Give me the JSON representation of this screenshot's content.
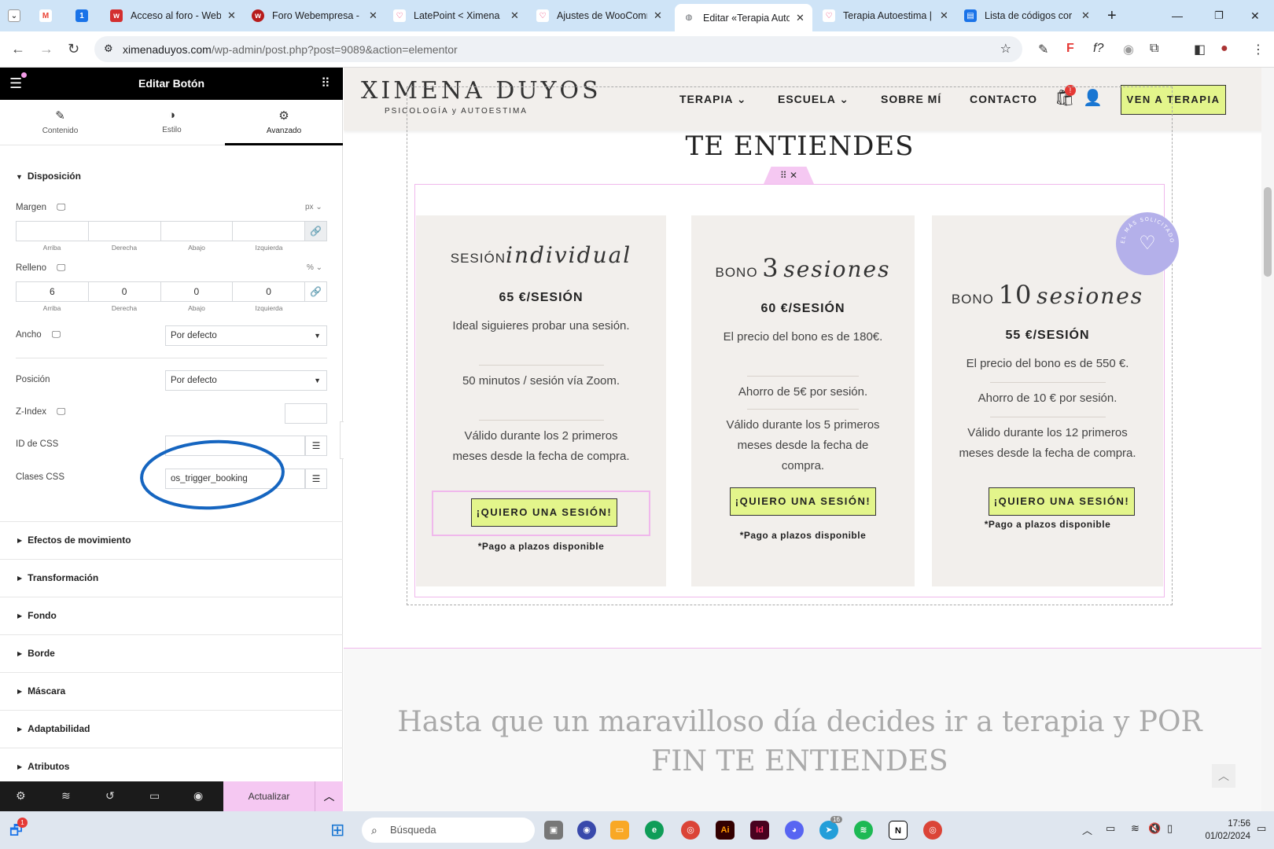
{
  "browser": {
    "tabs": [
      {
        "title": "",
        "icon": "gmail-icon",
        "color": "#ea4335"
      },
      {
        "title": "",
        "icon": "calendar-icon",
        "color": "#1a73e8"
      },
      {
        "title": "Acceso al foro - Web",
        "icon": "webempresa-icon",
        "color": "#d32f2f"
      },
      {
        "title": "Foro Webempresa - F",
        "icon": "webempresa-icon",
        "color": "#b71c1c"
      },
      {
        "title": "LatePoint < Ximena",
        "icon": "heart-icon",
        "color": "#e91e63"
      },
      {
        "title": "Ajustes de WooComm",
        "icon": "heart-icon",
        "color": "#e91e63"
      },
      {
        "title": "Editar «Terapia Auto",
        "icon": "globe-icon",
        "color": "#5f6368"
      },
      {
        "title": "Terapia Autoestima |",
        "icon": "heart-icon",
        "color": "#e91e63"
      },
      {
        "title": "Lista de códigos cor",
        "icon": "docs-icon",
        "color": "#1a73e8"
      }
    ],
    "url_host": "ximenaduyos.com",
    "url_path": "/wp-admin/post.php?post=9089&action=elementor"
  },
  "panel": {
    "title": "Editar Botón",
    "tabs": [
      "Contenido",
      "Estilo",
      "Avanzado"
    ],
    "section": "Disposición",
    "margin": {
      "label": "Margen",
      "unit": "px",
      "values": [
        "",
        "",
        "",
        ""
      ]
    },
    "padding": {
      "label": "Relleno",
      "unit": "%",
      "values": [
        "6",
        "0",
        "0",
        "0"
      ]
    },
    "sides": [
      "Arriba",
      "Derecha",
      "Abajo",
      "Izquierda"
    ],
    "width": {
      "label": "Ancho",
      "value": "Por defecto"
    },
    "position": {
      "label": "Posición",
      "value": "Por defecto"
    },
    "zindex": {
      "label": "Z-Index",
      "value": ""
    },
    "css_id": {
      "label": "ID de CSS",
      "value": ""
    },
    "css_classes": {
      "label": "Clases CSS",
      "value": "os_trigger_booking"
    },
    "accordions": [
      "Efectos de movimiento",
      "Transformación",
      "Fondo",
      "Borde",
      "Máscara",
      "Adaptabilidad",
      "Atributos"
    ],
    "update_label": "Actualizar"
  },
  "site": {
    "logo": "XIMENA DUYOS",
    "logo_sub": "PSICOLOGÍA y AUTOESTIMA",
    "menu": [
      "TERAPIA",
      "ESCUELA",
      "SOBRE MÍ",
      "CONTACTO"
    ],
    "cart_count": "!",
    "cta": "VEN A TERAPIA",
    "headline_top": "TE ENTIENDES",
    "badge_text": "EL MÁS SOLICITADO",
    "cards": [
      {
        "name_small": "SESIÓN",
        "name_script": "individual",
        "price": "65 €/SESIÓN",
        "items": [
          "Ideal siguieres probar una sesión.",
          "50 minutos / sesión vía Zoom.",
          "Válido durante los 2 primeros meses desde la fecha de compra."
        ],
        "button": "¡QUIERO UNA SESIÓN!",
        "note": "*Pago a plazos disponible"
      },
      {
        "name_small": "BONO",
        "name_big": "3",
        "name_script": "sesiones",
        "price": "60 €/SESIÓN",
        "items": [
          "El precio del bono es de 180€.",
          "Ahorro de 5€ por sesión.",
          "Válido durante los 5 primeros meses desde la fecha de compra."
        ],
        "button": "¡QUIERO UNA SESIÓN!",
        "note": "*Pago a plazos disponible"
      },
      {
        "name_small": "BONO",
        "name_big": "10",
        "name_script": "sesiones",
        "price": "55 €/SESIÓN",
        "items": [
          "El precio del bono es de 550 €.",
          "Ahorro de 10 € por sesión.",
          "Válido durante los 12 primeros meses desde la fecha de compra."
        ],
        "button": "¡QUIERO UNA SESIÓN!",
        "note": "*Pago a plazos disponible"
      }
    ],
    "headline_bottom": "Hasta que un maravilloso día decides ir a terapia y POR FIN TE ENTIENDES"
  },
  "taskbar": {
    "search_placeholder": "Búsqueda",
    "time": "17:56",
    "date": "01/02/2024",
    "telegram_badge": "16"
  }
}
